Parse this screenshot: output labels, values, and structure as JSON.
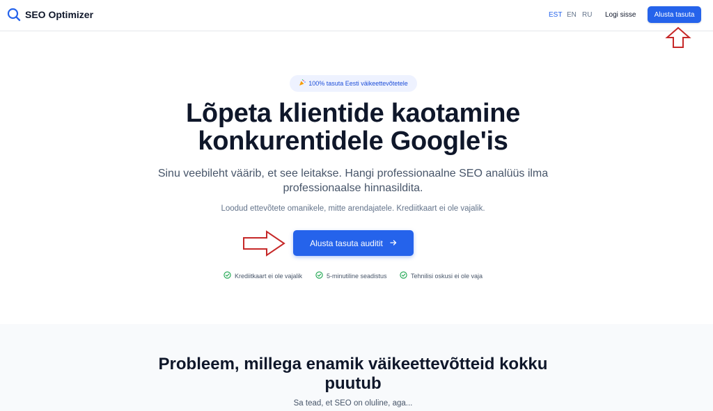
{
  "header": {
    "logo_text": "SEO Optimizer",
    "logo_icon": "search-icon",
    "languages": [
      {
        "label": "EST",
        "active": true
      },
      {
        "label": "EN",
        "active": false
      },
      {
        "label": "RU",
        "active": false
      }
    ],
    "login_label": "Logi sisse",
    "cta_label": "Alusta tasuta"
  },
  "hero": {
    "badge_icon": "party-popper-icon",
    "badge_text": "100% tasuta Eesti väikeettevõtetele",
    "title_line1": "Lõpeta klientide kaotamine",
    "title_line2": "konkurentidele Google'is",
    "subtitle_line1": "Sinu veebileht väärib, et see leitakse. Hangi professionaalne SEO analüüs ilma",
    "subtitle_line2": "professionaalse hinnasildita.",
    "note": "Loodud ettevõtete omanikele, mitte arendajatele. Krediitkaart ei ole vajalik.",
    "cta_label": "Alusta tasuta auditit",
    "cta_icon": "arrow-right-icon",
    "features": [
      {
        "icon": "check-circle-icon",
        "label": "Krediitkaart ei ole vajalik"
      },
      {
        "icon": "check-circle-icon",
        "label": "5-minutiline seadistus"
      },
      {
        "icon": "check-circle-icon",
        "label": "Tehnilisi oskusi ei ole vaja"
      }
    ]
  },
  "problem_section": {
    "title_line1": "Probleem, millega enamik väikeettevõtteid kokku",
    "title_line2": "puutub",
    "subtitle": "Sa tead, et SEO on oluline, aga..."
  },
  "colors": {
    "accent": "#2563eb",
    "annotation_arrow": "#c62828",
    "check": "#16a34a"
  }
}
